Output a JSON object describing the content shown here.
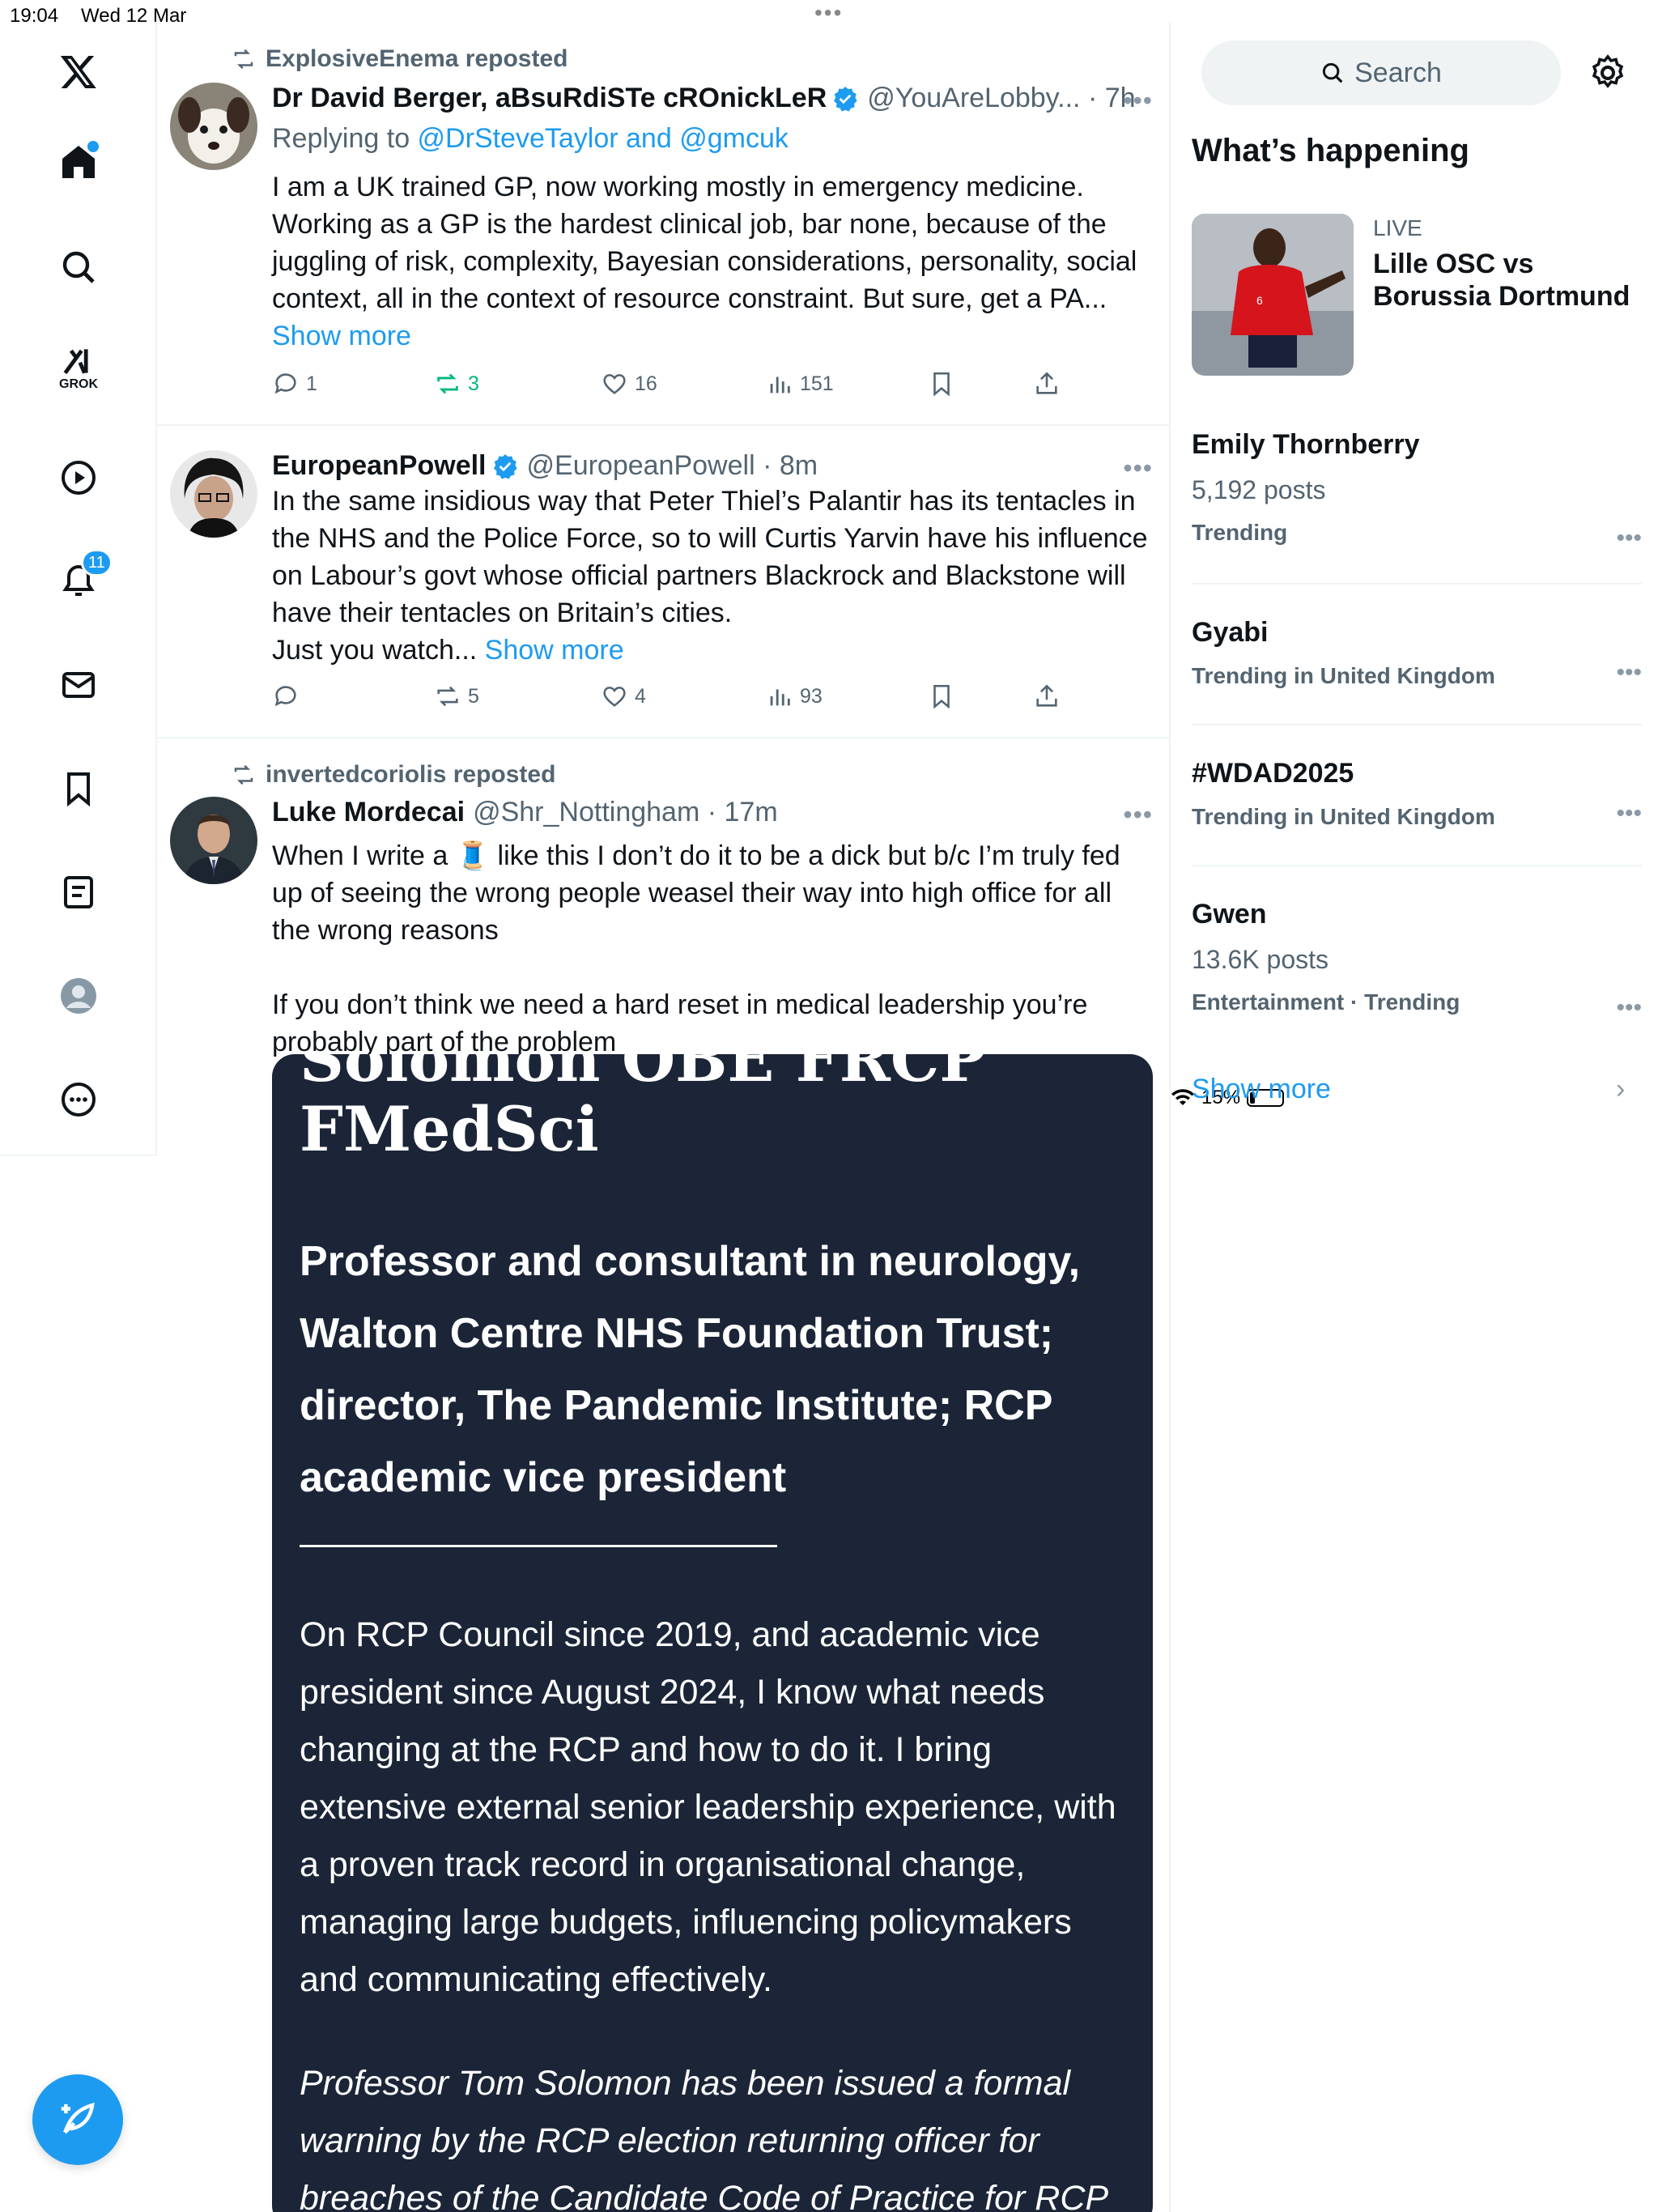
{
  "status_bar": {
    "time": "19:04",
    "date": "Wed 12 Mar",
    "battery": "15%"
  },
  "nav": {
    "grok_label": "GROK",
    "notifications_count": "11"
  },
  "posts": [
    {
      "reposted_by": "ExplosiveEnema reposted",
      "name": "Dr David Berger, aBsuRdiSTe cROnickLeR",
      "handle": "@YouAreLobby... · 7h",
      "replying_prefix": "Replying to ",
      "replying_to": "@DrSteveTaylor and @gmcuk",
      "text": "I am a UK trained GP, now working mostly in emergency medicine. Working as a GP is the hardest clinical job, bar none, because of the juggling of risk, complexity, Bayesian considerations, personality, social context, all in the context of resource constraint. But sure, get a PA... ",
      "show_more": "Show more",
      "replies": "1",
      "reposts": "3",
      "likes": "16",
      "views": "151"
    },
    {
      "name": "EuropeanPowell",
      "handle": "@EuropeanPowell · 8m",
      "text": "In the same insidious way that Peter Thiel’s Palantir has its tentacles in the NHS and the Police Force, so to will Curtis Yarvin have his influence on Labour’s govt whose official partners Blackrock and Blackstone will have their tentacles on Britain’s cities.\nJust you watch... ",
      "show_more": "Show more",
      "replies": "",
      "reposts": "5",
      "likes": "4",
      "views": "93"
    },
    {
      "reposted_by": "invertedcoriolis reposted",
      "name": "Luke Mordecai",
      "handle": "@Shr_Nottingham · 17m",
      "text_before_emoji": "When I write a ",
      "emoji": "🧵",
      "text_after_emoji": " like this I don’t do it to be a dick but b/c I’m truly fed up of seeing the wrong people weasel their way into high office for all the wrong reasons\n\nIf you don’t think we need a hard reset in medical leadership you’re probably part of the problem",
      "media": {
        "cut_title": "Solomon OBE FRCP",
        "title": "FMedSci",
        "subtitle": "Professor and consultant in neurology, Walton Centre NHS Foundation Trust; director, The Pandemic Institute; RCP academic vice president",
        "body": "On RCP Council since 2019, and academic vice president since August 2024, I know what needs changing at the RCP and how to do it. I bring extensive external senior leadership experience, with a proven track record in organisational change, managing large budgets, influencing policymakers and communicating effectively.",
        "italic": "Professor Tom Solomon has been issued a formal warning by the RCP election returning officer for breaches of the Candidate Code of Practice for RCP"
      }
    }
  ],
  "sidebar": {
    "search_placeholder": "Search",
    "heading": "What’s happening",
    "event": {
      "live": "LIVE",
      "title": "Lille OSC vs Borussia Dortmund"
    },
    "trends": [
      {
        "name": "Emily Thornberry",
        "posts": "5,192 posts",
        "meta": "Trending"
      },
      {
        "name": "Gyabi",
        "posts": "",
        "meta": "Trending in United Kingdom"
      },
      {
        "name": "#WDAD2025",
        "posts": "",
        "meta": "Trending in United Kingdom"
      },
      {
        "name": "Gwen",
        "posts": "13.6K posts",
        "meta": "Entertainment · Trending"
      }
    ],
    "show_more": "Show more"
  }
}
